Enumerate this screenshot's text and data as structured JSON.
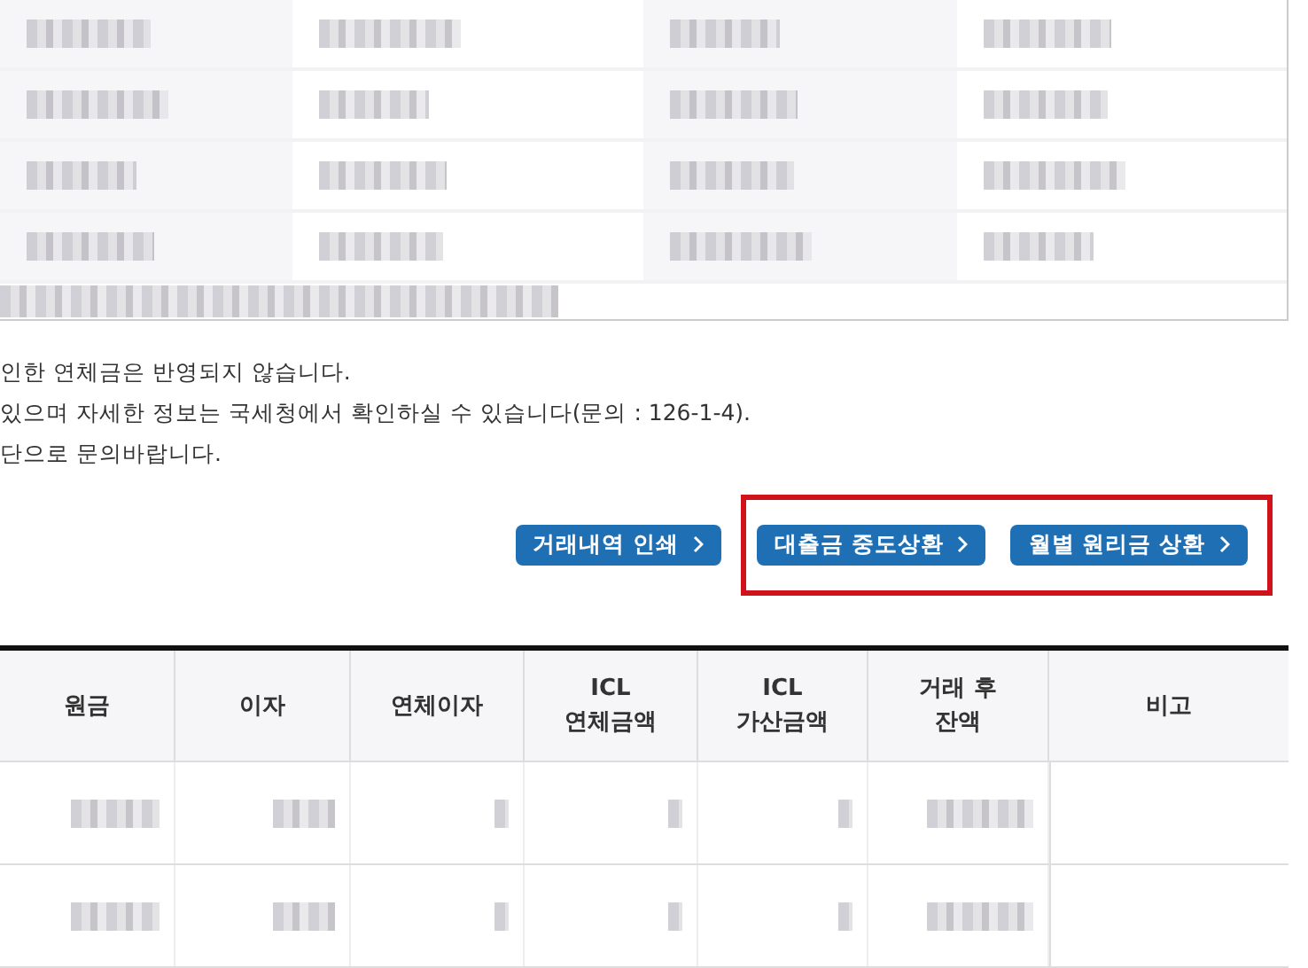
{
  "info_table": {
    "rows": [
      [
        {
          "redacted": true
        },
        {
          "redacted": true
        },
        {
          "redacted": true
        },
        {
          "redacted": true
        }
      ],
      [
        {
          "redacted": true
        },
        {
          "redacted": true
        },
        {
          "redacted": true
        },
        {
          "redacted": true
        }
      ],
      [
        {
          "redacted": true
        },
        {
          "redacted": true
        },
        {
          "redacted": true
        },
        {
          "redacted": true
        }
      ],
      [
        {
          "redacted": true
        },
        {
          "redacted": true
        },
        {
          "redacted": true
        },
        {
          "redacted": true
        }
      ]
    ],
    "footnote": {
      "redacted": true
    }
  },
  "notes": [
    "인한 연체금은 반영되지 않습니다.",
    "있으며 자세한 정보는 국세청에서 확인하실 수 있습니다(문의 : 126-1-4).",
    "단으로 문의바랍니다."
  ],
  "button_groups": [
    {
      "highlighted": false,
      "buttons": [
        {
          "label": "거래내역 인쇄"
        }
      ]
    },
    {
      "highlighted": true,
      "buttons": [
        {
          "label": "대출금 중도상환"
        },
        {
          "label": "월별 원리금 상환"
        }
      ]
    }
  ],
  "table": {
    "columns": [
      "원금",
      "이자",
      "연체이자",
      "ICL\n연체금액",
      "ICL\n가산금액",
      "거래 후\n잔액",
      "비고"
    ],
    "rows": [
      [
        {
          "redacted": true
        },
        {
          "redacted": true
        },
        {
          "redacted": true
        },
        {
          "redacted": true
        },
        {
          "redacted": true
        },
        {
          "redacted": true
        },
        {
          "redacted": false
        }
      ],
      [
        {
          "redacted": true
        },
        {
          "redacted": true
        },
        {
          "redacted": true
        },
        {
          "redacted": true
        },
        {
          "redacted": true
        },
        {
          "redacted": true
        },
        {
          "redacted": false
        }
      ]
    ]
  }
}
